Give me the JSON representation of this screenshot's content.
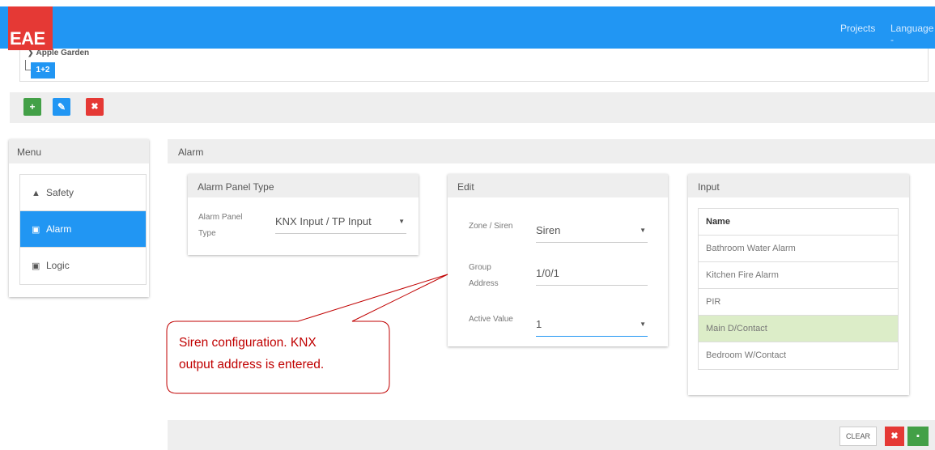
{
  "header": {
    "logo": "EAE",
    "nav_projects": "Projects",
    "nav_language": "Language -"
  },
  "tree": {
    "root_label": "Apple Garden",
    "child_label": "1+2"
  },
  "toolbar": {
    "add_glyph": "+",
    "edit_glyph": "✎",
    "delete_glyph": "✖"
  },
  "menu": {
    "title": "Menu",
    "items": [
      {
        "label": "Safety",
        "icon": "warning-icon",
        "glyph": "▲"
      },
      {
        "label": "Alarm",
        "icon": "panel-icon",
        "glyph": "▣"
      },
      {
        "label": "Logic",
        "icon": "panel-icon",
        "glyph": "▣"
      }
    ]
  },
  "alarm": {
    "title": "Alarm",
    "panel_type": {
      "title": "Alarm Panel Type",
      "label_line1": "Alarm Panel",
      "label_line2": "Type",
      "value": "KNX Input / TP Input"
    },
    "edit": {
      "title": "Edit",
      "zone_label": "Zone / Siren",
      "zone_value": "Siren",
      "group_label_line1": "Group",
      "group_label_line2": "Address",
      "group_value": "1/0/1",
      "active_label": "Active Value",
      "active_value": "1"
    },
    "input": {
      "title": "Input",
      "column": "Name",
      "rows": [
        "Bathroom Water Alarm",
        "Kitchen Fire Alarm",
        "PIR",
        "Main D/Contact",
        "Bedroom W/Contact"
      ]
    }
  },
  "footer": {
    "clear_label": "CLEAR",
    "cancel_glyph": "✖",
    "save_glyph": "▪"
  },
  "callout": {
    "line1": "Siren configuration. KNX",
    "line2": "output address is entered."
  },
  "colors": {
    "primary": "#2196f3",
    "danger": "#e53935",
    "success": "#43a047",
    "highlight_row": "#dcedc8",
    "callout": "#c00000"
  }
}
